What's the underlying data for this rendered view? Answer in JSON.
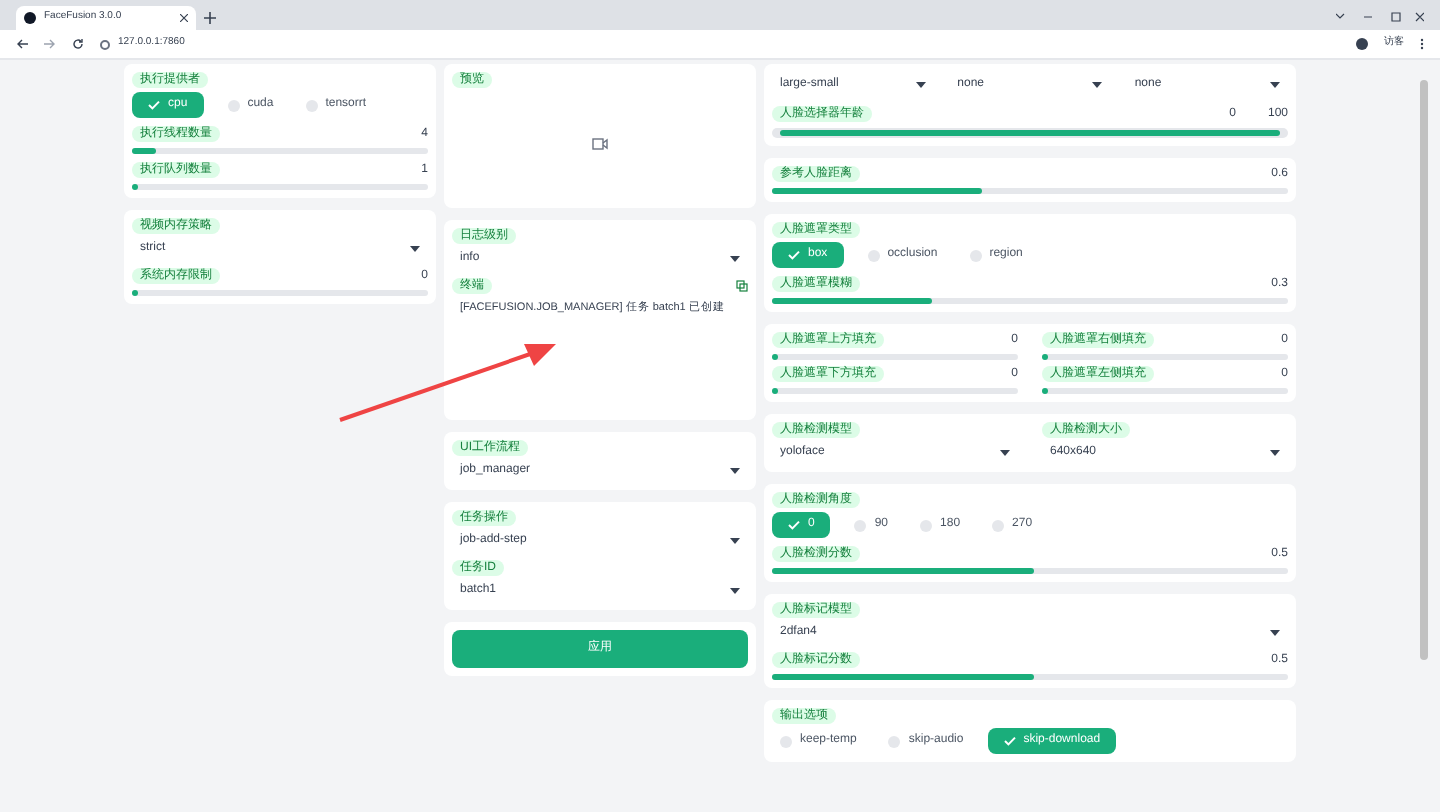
{
  "browser": {
    "tab_title": "FaceFusion 3.0.0",
    "url": "127.0.0.1:7860",
    "profile_label": "访客"
  },
  "columns": [
    {
      "cards": [
        {
          "items": [
            {
              "kind": "checkboxes",
              "label": "执行提供者",
              "options": [
                {
                  "label": "cpu",
                  "checked": true
                },
                {
                  "label": "cuda",
                  "checked": false
                },
                {
                  "label": "tensorrt",
                  "checked": false
                }
              ]
            },
            {
              "kind": "slider",
              "label": "执行线程数量",
              "value": "4",
              "level": 0.06
            },
            {
              "kind": "slider",
              "label": "执行队列数量",
              "value": "1",
              "level": 0
            }
          ]
        },
        {
          "items": [
            {
              "kind": "select",
              "label": "视频内存策略",
              "value": "strict"
            },
            {
              "kind": "slider",
              "label": "系统内存限制",
              "value": "0",
              "level": 0
            }
          ]
        }
      ]
    },
    {
      "cards": [
        {
          "items": [
            {
              "kind": "preview",
              "label": "预览"
            }
          ]
        },
        {
          "items": [
            {
              "kind": "select",
              "label": "日志级别",
              "value": "info"
            },
            {
              "kind": "terminal",
              "label": "终端",
              "text": "[FACEFUSION.JOB_MANAGER] 任务 batch1 已创建"
            }
          ]
        },
        {
          "items": [
            {
              "kind": "select",
              "label": "UI工作流程",
              "value": "job_manager"
            }
          ]
        },
        {
          "items": [
            {
              "kind": "select",
              "label": "任务操作",
              "value": "job-add-step"
            },
            {
              "kind": "select",
              "label": "任务ID",
              "value": "batch1"
            }
          ]
        },
        {
          "items": [
            {
              "kind": "button",
              "label": "应用"
            }
          ]
        }
      ]
    },
    {
      "cards": [
        {
          "items": [
            {
              "kind": "select_row",
              "values": [
                "large-small",
                "none",
                "none"
              ]
            },
            {
              "kind": "range",
              "label": "人脸选择器年龄",
              "values": [
                "0",
                "100"
              ],
              "level": 1
            }
          ]
        },
        {
          "items": [
            {
              "kind": "slider",
              "label": "参考人脸距离",
              "value": "0.6",
              "level": 0.4
            }
          ]
        },
        {
          "items": [
            {
              "kind": "checkboxes",
              "label": "人脸遮罩类型",
              "options": [
                {
                  "label": "box",
                  "checked": true
                },
                {
                  "label": "occlusion",
                  "checked": false
                },
                {
                  "label": "region",
                  "checked": false
                }
              ]
            },
            {
              "kind": "slider",
              "label": "人脸遮罩模糊",
              "value": "0.3",
              "level": 0.3
            }
          ]
        },
        {
          "items": [
            {
              "kind": "grid",
              "items": [
                {
                  "kind": "slider",
                  "label": "人脸遮罩上方填充",
                  "value": "0",
                  "level": 0
                },
                {
                  "kind": "slider",
                  "label": "人脸遮罩右侧填充",
                  "value": "0",
                  "level": 0
                },
                {
                  "kind": "slider",
                  "label": "人脸遮罩下方填充",
                  "value": "0",
                  "level": 0
                },
                {
                  "kind": "slider",
                  "label": "人脸遮罩左侧填充",
                  "value": "0",
                  "level": 0
                }
              ]
            }
          ]
        },
        {
          "items": [
            {
              "kind": "grid",
              "items": [
                {
                  "kind": "select",
                  "label": "人脸检测模型",
                  "value": "yoloface"
                },
                {
                  "kind": "select",
                  "label": "人脸检测大小",
                  "value": "640x640"
                }
              ]
            }
          ]
        },
        {
          "items": [
            {
              "kind": "checkboxes",
              "label": "人脸检测角度",
              "options": [
                {
                  "label": "0",
                  "checked": true
                },
                {
                  "label": "90",
                  "checked": false
                },
                {
                  "label": "180",
                  "checked": false
                },
                {
                  "label": "270",
                  "checked": false
                }
              ]
            },
            {
              "kind": "slider",
              "label": "人脸检测分数",
              "value": "0.5",
              "level": 0.5
            }
          ]
        },
        {
          "items": [
            {
              "kind": "select",
              "label": "人脸标记模型",
              "value": "2dfan4"
            },
            {
              "kind": "slider",
              "label": "人脸标记分数",
              "value": "0.5",
              "level": 0.5
            }
          ]
        },
        {
          "items": [
            {
              "kind": "checkboxes",
              "label": "输出选项",
              "options": [
                {
                  "label": "keep-temp",
                  "checked": false
                },
                {
                  "label": "skip-audio",
                  "checked": false
                },
                {
                  "label": "skip-download",
                  "checked": true
                }
              ]
            }
          ]
        }
      ]
    }
  ]
}
